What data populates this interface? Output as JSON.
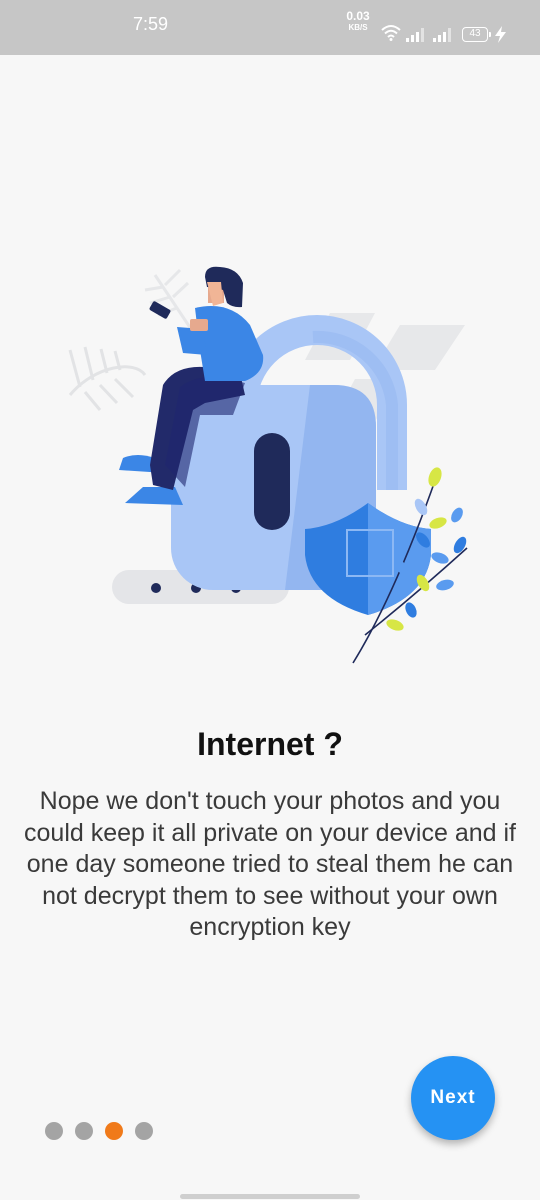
{
  "status_bar": {
    "time": "7:59",
    "net_speed_value": "0.03",
    "net_speed_unit": "KB/S",
    "battery": "43",
    "icons": [
      "wifi-icon",
      "signal-icon",
      "signal-icon",
      "battery-icon",
      "charging-icon"
    ]
  },
  "onboarding": {
    "title": "Internet ?",
    "description": "Nope we don't touch your photos and you could keep it all private on your device and if one day someone tried to steal them he can not decrypt them to see without your own encryption key",
    "current_page": 3,
    "total_pages": 4,
    "next_label": "Next"
  },
  "colors": {
    "status_bar": "#c6c6c6",
    "background": "#f7f7f7",
    "accent_blue": "#2592f3",
    "active_dot": "#f07a1a",
    "inactive_dot": "#a4a4a4"
  }
}
